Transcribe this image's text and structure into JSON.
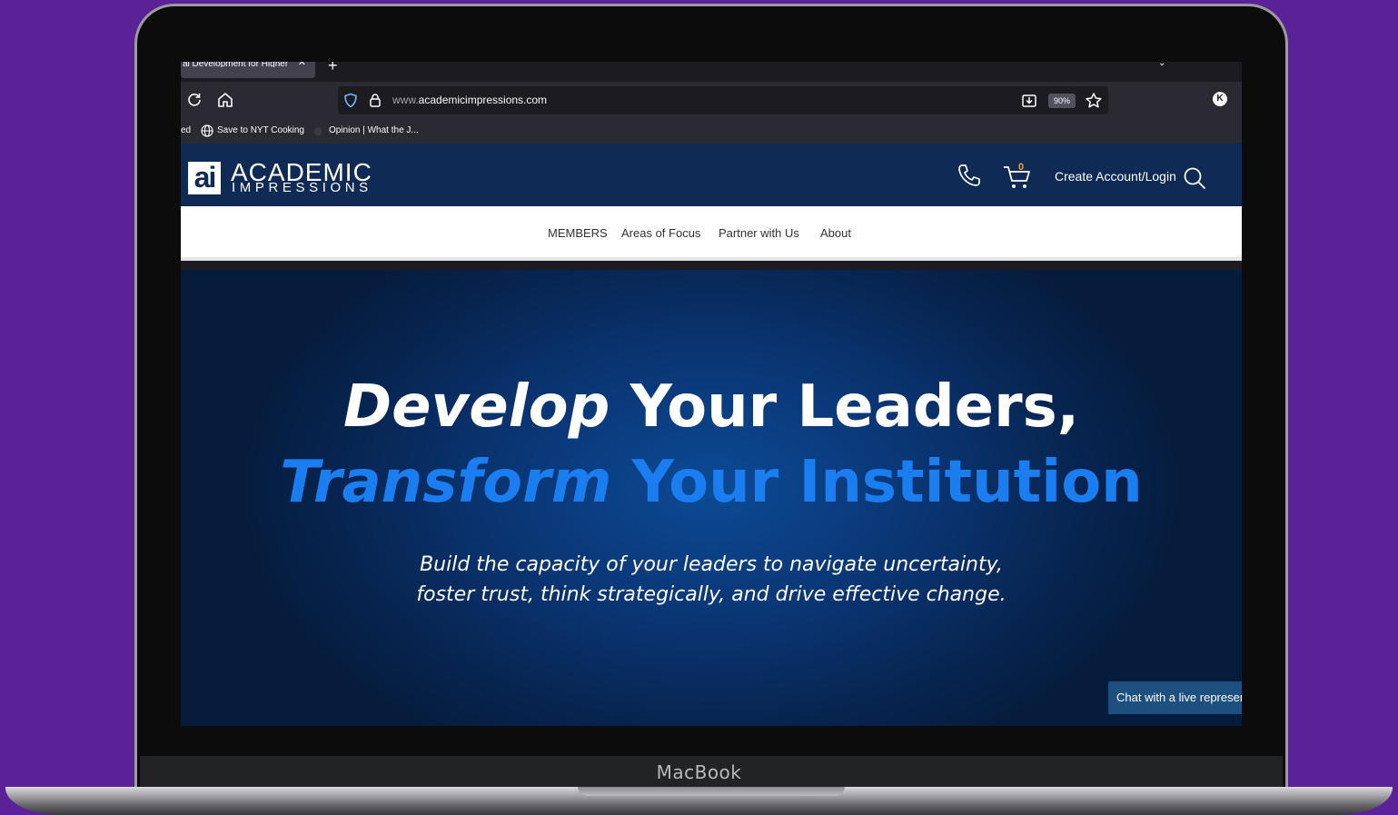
{
  "browser": {
    "tab_title": "al Development for Higher",
    "url_prefix": "www.",
    "url_domain": "academicimpressions.com",
    "zoom": "90%",
    "profile_initial": "K",
    "bookmarks": [
      {
        "label": "ed"
      },
      {
        "label": "Save to NYT Cooking"
      },
      {
        "label": "Opinion | What the J..."
      }
    ]
  },
  "site": {
    "logo_mark": "ai",
    "logo_line1": "ACADEMIC",
    "logo_line2": "IMPRESSIONS",
    "cart_count": "0",
    "login_label": "Create Account/Login",
    "nav": [
      {
        "label": "MEMBERS"
      },
      {
        "label": "Areas of Focus"
      },
      {
        "label": "Partner with Us"
      },
      {
        "label": "About"
      }
    ],
    "hero": {
      "line1_em": "Develop",
      "line1_rest": " Your Leaders,",
      "line2_em": "Transform",
      "line2_rest": " Your Institution",
      "sub_line1": "Build the capacity of your leaders to navigate uncertainty,",
      "sub_line2": "foster trust, think strategically, and drive effective change."
    },
    "chat_label": "Chat with a live representative",
    "colors": {
      "header_bg": "#0e2a55",
      "accent_blue": "#1a7ef0",
      "cart_badge": "#f5a623"
    }
  },
  "device": {
    "brand": "MacBook",
    "background": "#5b2196"
  }
}
